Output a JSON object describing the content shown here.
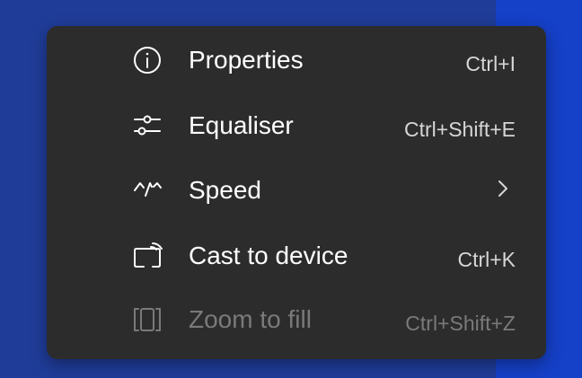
{
  "context_menu": {
    "items": [
      {
        "label": "Properties",
        "shortcut": "Ctrl+I",
        "icon": "info-icon",
        "enabled": true
      },
      {
        "label": "Equaliser",
        "shortcut": "Ctrl+Shift+E",
        "icon": "sliders-icon",
        "enabled": true
      },
      {
        "label": "Speed",
        "shortcut": "",
        "icon": "speedometer-icon",
        "submenu": true,
        "enabled": true
      },
      {
        "label": "Cast to device",
        "shortcut": "Ctrl+K",
        "icon": "cast-icon",
        "enabled": true
      },
      {
        "label": "Zoom to fill",
        "shortcut": "Ctrl+Shift+Z",
        "icon": "zoom-fill-icon",
        "enabled": false
      }
    ]
  },
  "colors": {
    "menu_background": "#2c2c2c",
    "desktop_background": "#1f3c98",
    "text": "#ffffff",
    "disabled_text": "#7a7a7a"
  }
}
